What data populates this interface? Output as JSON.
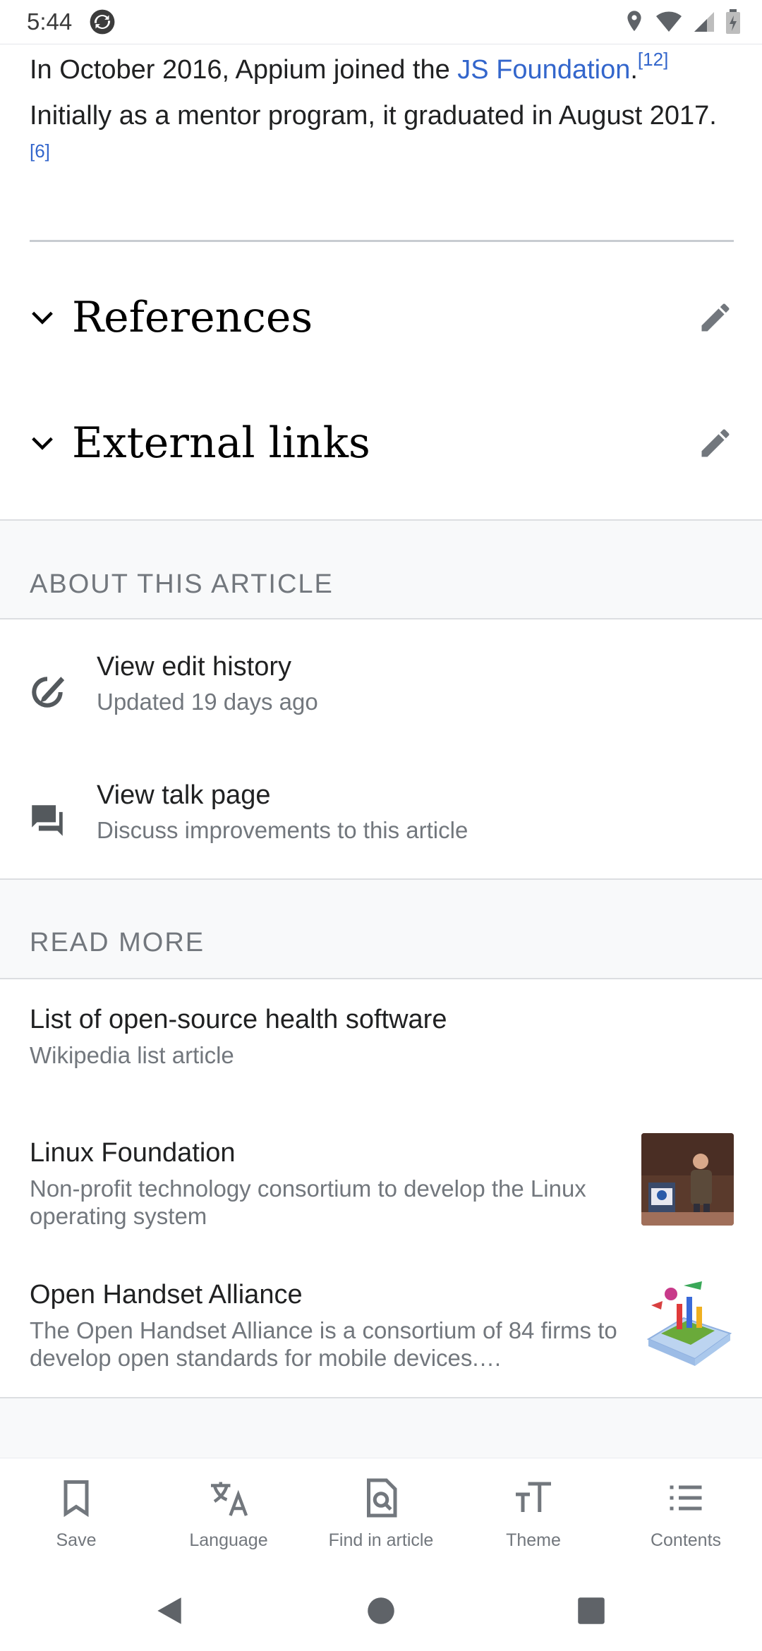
{
  "status_bar": {
    "time": "5:44"
  },
  "article": {
    "line1_prefix": "In October 2016, Appium joined the ",
    "link_text": "JS Foundation",
    "line1_suffix": ".",
    "ref1": "[12]",
    "line2": "Initially as a mentor program, it graduated in August 2017. ",
    "ref2": "[6]"
  },
  "sections": [
    {
      "title": "References"
    },
    {
      "title": "External links"
    }
  ],
  "about": {
    "header": "ABOUT THIS ARTICLE",
    "items": [
      {
        "title": "View edit history",
        "subtitle": "Updated 19 days ago",
        "icon": "edit-history-icon"
      },
      {
        "title": "View talk page",
        "subtitle": "Discuss improvements to this article",
        "icon": "talk-page-icon"
      }
    ]
  },
  "read_more": {
    "header": "READ MORE",
    "items": [
      {
        "title": "List of open-source health software",
        "description": "Wikipedia list article"
      },
      {
        "title": "Linux Foundation",
        "description": "Non-profit technology consortium to develop the Linux operating system"
      },
      {
        "title": "Open Handset Alliance",
        "description": "The Open Handset Alliance is a consortium of 84 firms to develop open standards for mobile devices.…"
      }
    ]
  },
  "toolbar": {
    "items": [
      {
        "label": "Save",
        "icon": "bookmark-icon"
      },
      {
        "label": "Language",
        "icon": "translate-icon"
      },
      {
        "label": "Find in article",
        "icon": "find-in-page-icon"
      },
      {
        "label": "Theme",
        "icon": "text-size-icon"
      },
      {
        "label": "Contents",
        "icon": "list-icon"
      }
    ]
  },
  "colors": {
    "link": "#3366cc",
    "text": "#202122",
    "secondary": "#72777d",
    "band": "#f8f9fa"
  }
}
